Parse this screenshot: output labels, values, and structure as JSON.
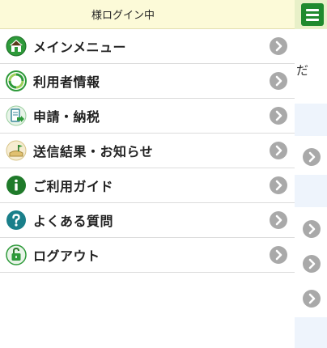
{
  "header": {
    "login_status": "様ログイン中"
  },
  "menu": {
    "items": [
      {
        "label": "メインメニュー",
        "icon": "home-icon"
      },
      {
        "label": "利用者情報",
        "icon": "user-info-icon"
      },
      {
        "label": "申請・納税",
        "icon": "application-tax-icon"
      },
      {
        "label": "送信結果・お知らせ",
        "icon": "notification-icon"
      },
      {
        "label": "ご利用ガイド",
        "icon": "info-icon"
      },
      {
        "label": "よくある質問",
        "icon": "question-icon"
      },
      {
        "label": "ログアウト",
        "icon": "logout-icon"
      }
    ]
  },
  "background": {
    "partial_text": "だ"
  },
  "colors": {
    "header_bg": "#fcfad8",
    "accent_green": "#1f8a2e",
    "chevron_gray": "#a9a9a9"
  }
}
